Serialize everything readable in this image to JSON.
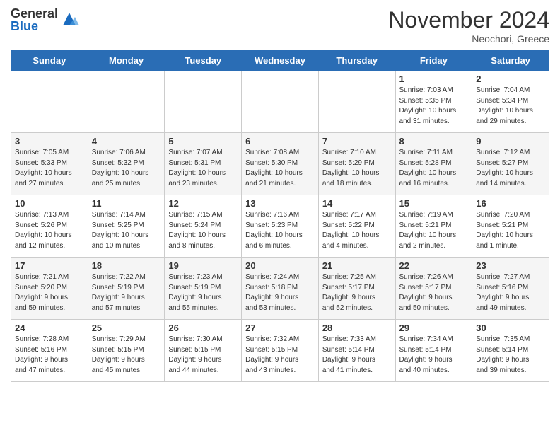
{
  "header": {
    "logo_general": "General",
    "logo_blue": "Blue",
    "month_title": "November 2024",
    "location": "Neochori, Greece"
  },
  "days_of_week": [
    "Sunday",
    "Monday",
    "Tuesday",
    "Wednesday",
    "Thursday",
    "Friday",
    "Saturday"
  ],
  "weeks": [
    [
      {
        "day": "",
        "info": ""
      },
      {
        "day": "",
        "info": ""
      },
      {
        "day": "",
        "info": ""
      },
      {
        "day": "",
        "info": ""
      },
      {
        "day": "",
        "info": ""
      },
      {
        "day": "1",
        "info": "Sunrise: 7:03 AM\nSunset: 5:35 PM\nDaylight: 10 hours\nand 31 minutes."
      },
      {
        "day": "2",
        "info": "Sunrise: 7:04 AM\nSunset: 5:34 PM\nDaylight: 10 hours\nand 29 minutes."
      }
    ],
    [
      {
        "day": "3",
        "info": "Sunrise: 7:05 AM\nSunset: 5:33 PM\nDaylight: 10 hours\nand 27 minutes."
      },
      {
        "day": "4",
        "info": "Sunrise: 7:06 AM\nSunset: 5:32 PM\nDaylight: 10 hours\nand 25 minutes."
      },
      {
        "day": "5",
        "info": "Sunrise: 7:07 AM\nSunset: 5:31 PM\nDaylight: 10 hours\nand 23 minutes."
      },
      {
        "day": "6",
        "info": "Sunrise: 7:08 AM\nSunset: 5:30 PM\nDaylight: 10 hours\nand 21 minutes."
      },
      {
        "day": "7",
        "info": "Sunrise: 7:10 AM\nSunset: 5:29 PM\nDaylight: 10 hours\nand 18 minutes."
      },
      {
        "day": "8",
        "info": "Sunrise: 7:11 AM\nSunset: 5:28 PM\nDaylight: 10 hours\nand 16 minutes."
      },
      {
        "day": "9",
        "info": "Sunrise: 7:12 AM\nSunset: 5:27 PM\nDaylight: 10 hours\nand 14 minutes."
      }
    ],
    [
      {
        "day": "10",
        "info": "Sunrise: 7:13 AM\nSunset: 5:26 PM\nDaylight: 10 hours\nand 12 minutes."
      },
      {
        "day": "11",
        "info": "Sunrise: 7:14 AM\nSunset: 5:25 PM\nDaylight: 10 hours\nand 10 minutes."
      },
      {
        "day": "12",
        "info": "Sunrise: 7:15 AM\nSunset: 5:24 PM\nDaylight: 10 hours\nand 8 minutes."
      },
      {
        "day": "13",
        "info": "Sunrise: 7:16 AM\nSunset: 5:23 PM\nDaylight: 10 hours\nand 6 minutes."
      },
      {
        "day": "14",
        "info": "Sunrise: 7:17 AM\nSunset: 5:22 PM\nDaylight: 10 hours\nand 4 minutes."
      },
      {
        "day": "15",
        "info": "Sunrise: 7:19 AM\nSunset: 5:21 PM\nDaylight: 10 hours\nand 2 minutes."
      },
      {
        "day": "16",
        "info": "Sunrise: 7:20 AM\nSunset: 5:21 PM\nDaylight: 10 hours\nand 1 minute."
      }
    ],
    [
      {
        "day": "17",
        "info": "Sunrise: 7:21 AM\nSunset: 5:20 PM\nDaylight: 9 hours\nand 59 minutes."
      },
      {
        "day": "18",
        "info": "Sunrise: 7:22 AM\nSunset: 5:19 PM\nDaylight: 9 hours\nand 57 minutes."
      },
      {
        "day": "19",
        "info": "Sunrise: 7:23 AM\nSunset: 5:19 PM\nDaylight: 9 hours\nand 55 minutes."
      },
      {
        "day": "20",
        "info": "Sunrise: 7:24 AM\nSunset: 5:18 PM\nDaylight: 9 hours\nand 53 minutes."
      },
      {
        "day": "21",
        "info": "Sunrise: 7:25 AM\nSunset: 5:17 PM\nDaylight: 9 hours\nand 52 minutes."
      },
      {
        "day": "22",
        "info": "Sunrise: 7:26 AM\nSunset: 5:17 PM\nDaylight: 9 hours\nand 50 minutes."
      },
      {
        "day": "23",
        "info": "Sunrise: 7:27 AM\nSunset: 5:16 PM\nDaylight: 9 hours\nand 49 minutes."
      }
    ],
    [
      {
        "day": "24",
        "info": "Sunrise: 7:28 AM\nSunset: 5:16 PM\nDaylight: 9 hours\nand 47 minutes."
      },
      {
        "day": "25",
        "info": "Sunrise: 7:29 AM\nSunset: 5:15 PM\nDaylight: 9 hours\nand 45 minutes."
      },
      {
        "day": "26",
        "info": "Sunrise: 7:30 AM\nSunset: 5:15 PM\nDaylight: 9 hours\nand 44 minutes."
      },
      {
        "day": "27",
        "info": "Sunrise: 7:32 AM\nSunset: 5:15 PM\nDaylight: 9 hours\nand 43 minutes."
      },
      {
        "day": "28",
        "info": "Sunrise: 7:33 AM\nSunset: 5:14 PM\nDaylight: 9 hours\nand 41 minutes."
      },
      {
        "day": "29",
        "info": "Sunrise: 7:34 AM\nSunset: 5:14 PM\nDaylight: 9 hours\nand 40 minutes."
      },
      {
        "day": "30",
        "info": "Sunrise: 7:35 AM\nSunset: 5:14 PM\nDaylight: 9 hours\nand 39 minutes."
      }
    ]
  ]
}
